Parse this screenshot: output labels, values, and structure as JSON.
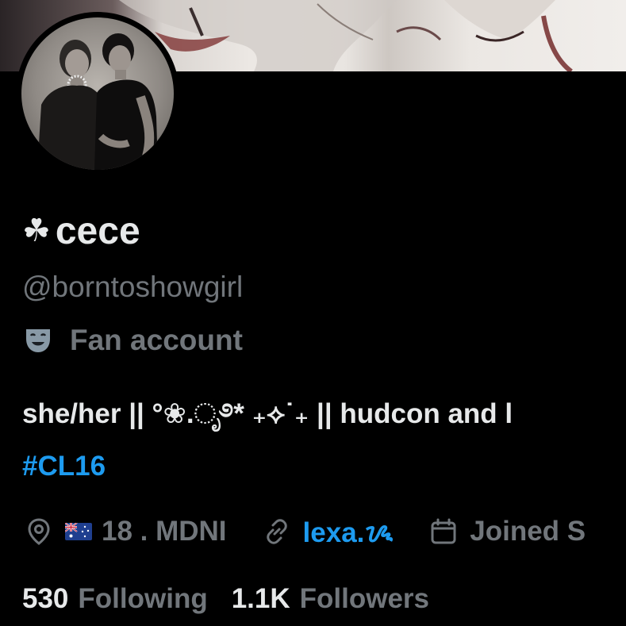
{
  "profile": {
    "name_prefix": "☘",
    "display_name": "cece",
    "handle": "@borntoshowgirl",
    "category_icon": "theater-masks-icon",
    "category": "Fan account",
    "bio": "she/her || °❀.ೃ࿔* ₊⟡˙₊ || hudcon and l",
    "hashtag": "#CL16",
    "location_flag": "australia-flag",
    "location": "18 . MDNI",
    "link": "lexa.ᝰ",
    "joined": "Joined S",
    "following_count": "530",
    "following_label": "Following",
    "followers_count": "1.1K",
    "followers_label": "Followers"
  },
  "colors": {
    "background": "#000000",
    "primary_text": "#e7e9ea",
    "secondary_text": "#71767b",
    "link": "#1d9bf0"
  }
}
